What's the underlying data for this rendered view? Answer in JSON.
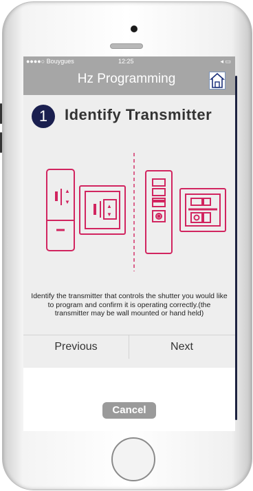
{
  "status_bar": {
    "carrier": "●●●●○ Bouygues",
    "time": "12:25",
    "right_icons": "◂ ▭"
  },
  "header": {
    "title": "Hz Programming"
  },
  "step": {
    "number": "1",
    "title": "Identify Transmitter"
  },
  "description": "Identify the transmitter that controls the shutter you would like to program and confirm it is operating correctly.(the transmitter may be wall mounted or hand held)",
  "nav": {
    "previous": "Previous",
    "next": "Next"
  },
  "cancel_label": "Cancel",
  "colors": {
    "accent": "#d1245f",
    "header_bg": "#a6a6a6",
    "step_circle": "#1a1f4f"
  }
}
